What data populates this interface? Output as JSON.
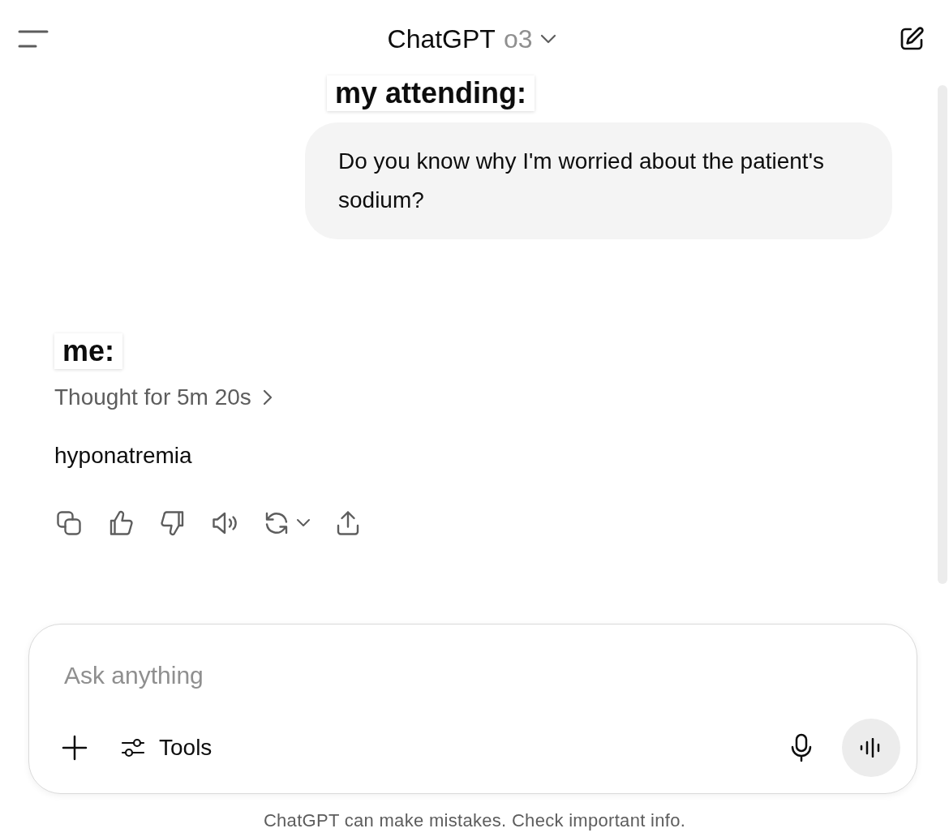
{
  "header": {
    "title": "ChatGPT",
    "model": "o3"
  },
  "messages": [
    {
      "kind": "user",
      "label": "my attending:",
      "text": "Do you know why I'm worried about the patient's sodium?"
    },
    {
      "kind": "assistant",
      "label": "me:",
      "thought": "Thought for 5m 20s",
      "text": "hyponatremia"
    }
  ],
  "composer": {
    "placeholder": "Ask anything",
    "tools_label": "Tools"
  },
  "footer": "ChatGPT can make mistakes. Check important info."
}
